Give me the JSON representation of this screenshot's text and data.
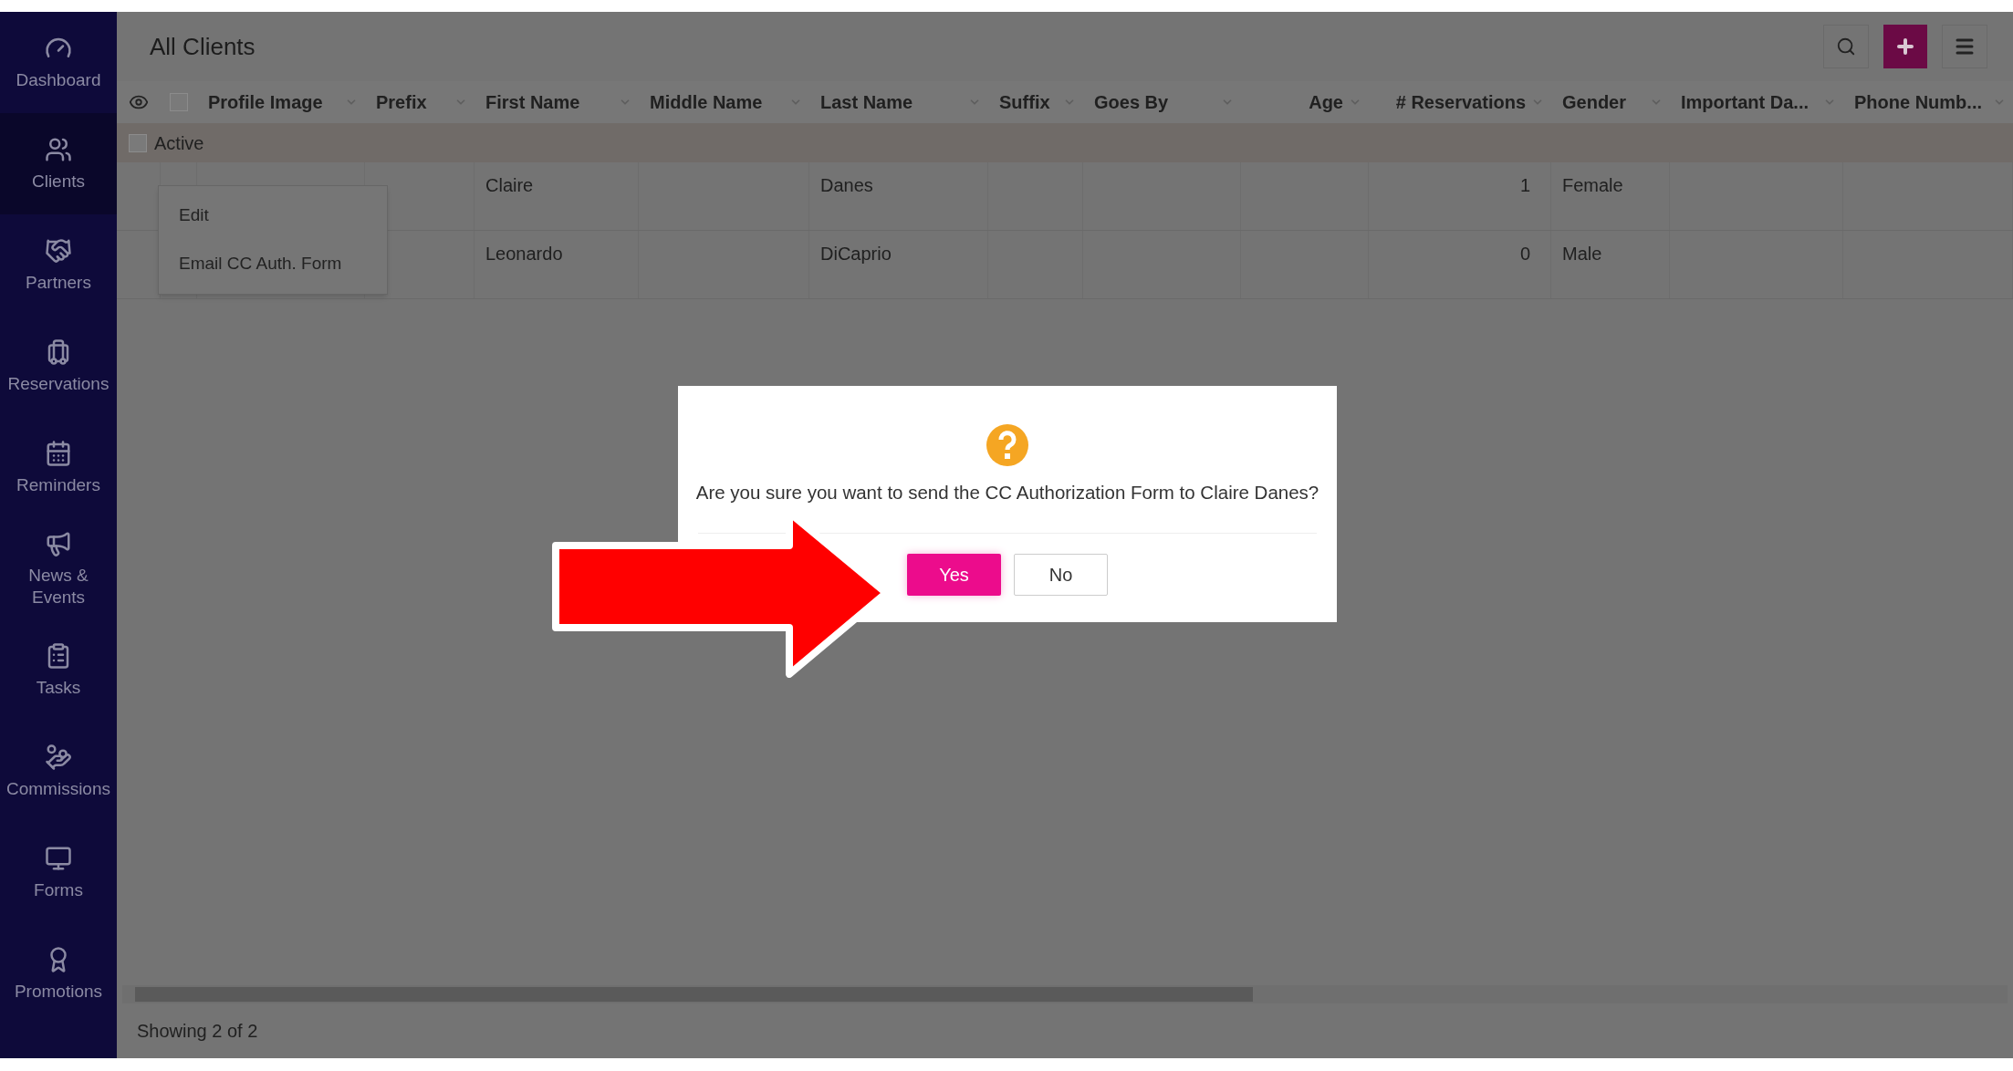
{
  "sidebar": {
    "items": [
      {
        "label": "Dashboard",
        "selected": false
      },
      {
        "label": "Clients",
        "selected": true
      },
      {
        "label": "Partners",
        "selected": false
      },
      {
        "label": "Reservations",
        "selected": false
      },
      {
        "label": "Reminders",
        "selected": false
      },
      {
        "label": "News & Events",
        "selected": false
      },
      {
        "label": "Tasks",
        "selected": false
      },
      {
        "label": "Commissions",
        "selected": false
      },
      {
        "label": "Forms",
        "selected": false
      },
      {
        "label": "Promotions",
        "selected": false
      }
    ]
  },
  "page": {
    "title": "All Clients"
  },
  "table": {
    "select_all": {
      "checked": false
    },
    "columns": [
      "Profile Image",
      "Prefix",
      "First Name",
      "Middle Name",
      "Last Name",
      "Suffix",
      "Goes By",
      "Age",
      "# Reservations",
      "Gender",
      "Important Da...",
      "Phone Numb..."
    ],
    "group": {
      "label": "Active",
      "checked": false
    },
    "rows": [
      {
        "first_name": "Claire",
        "last_name": "Danes",
        "reservations": "1",
        "gender": "Female"
      },
      {
        "first_name": "Leonardo",
        "last_name": "DiCaprio",
        "reservations": "0",
        "gender": "Male"
      }
    ]
  },
  "context_menu": {
    "items": [
      "Edit",
      "Email CC Auth. Form"
    ]
  },
  "dialog": {
    "message": "Are you sure you want to send the CC Authorization Form to Claire Danes?",
    "buttons": [
      {
        "label": "Yes",
        "kind": "primary"
      },
      {
        "label": "No",
        "kind": "secondary"
      }
    ]
  },
  "footer": {
    "status": "Showing 2 of 2"
  }
}
